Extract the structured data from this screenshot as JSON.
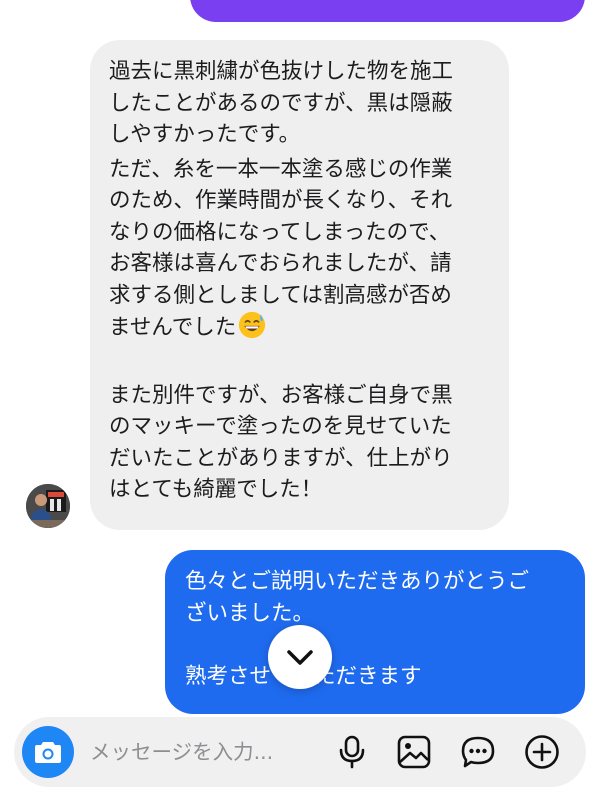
{
  "conversation": {
    "incoming": {
      "paragraphs": [
        "過去に黒刺繍が色抜けした物を施工\nしたことがあるのですが、黒は隠蔽\nしやすかったです。",
        "ただ、糸を一本一本塗る感じの作業\nのため、作業時間が長くなり、それ\nなりの価格になってしまったので、\nお客様は喜んでおられましたが、請\n求する側としましては割高感が否め\nませんでした",
        "また別件ですが、お客様ご自身で黒\nのマッキーで塗ったのを見せていた\nだいたことがありますが、仕上がり\nはとても綺麗でした！"
      ],
      "emoji": "sweat-smile-emoji",
      "bubble_color": "#efefef"
    },
    "outgoing": {
      "paragraphs": [
        "色々とご説明いただきありがとうご\nざいました。",
        "熟考させていただきます"
      ],
      "bubble_color": "#1f6bf0"
    },
    "previous_outgoing_color": "#7b3ff2"
  },
  "scroll_button": {
    "icon": "chevron-down-icon"
  },
  "composer": {
    "placeholder": "メッセージを入力...",
    "camera_color": "#1e86f5",
    "icons": [
      "camera-icon",
      "microphone-icon",
      "image-icon",
      "sticker-chat-icon",
      "plus-circle-icon"
    ]
  }
}
